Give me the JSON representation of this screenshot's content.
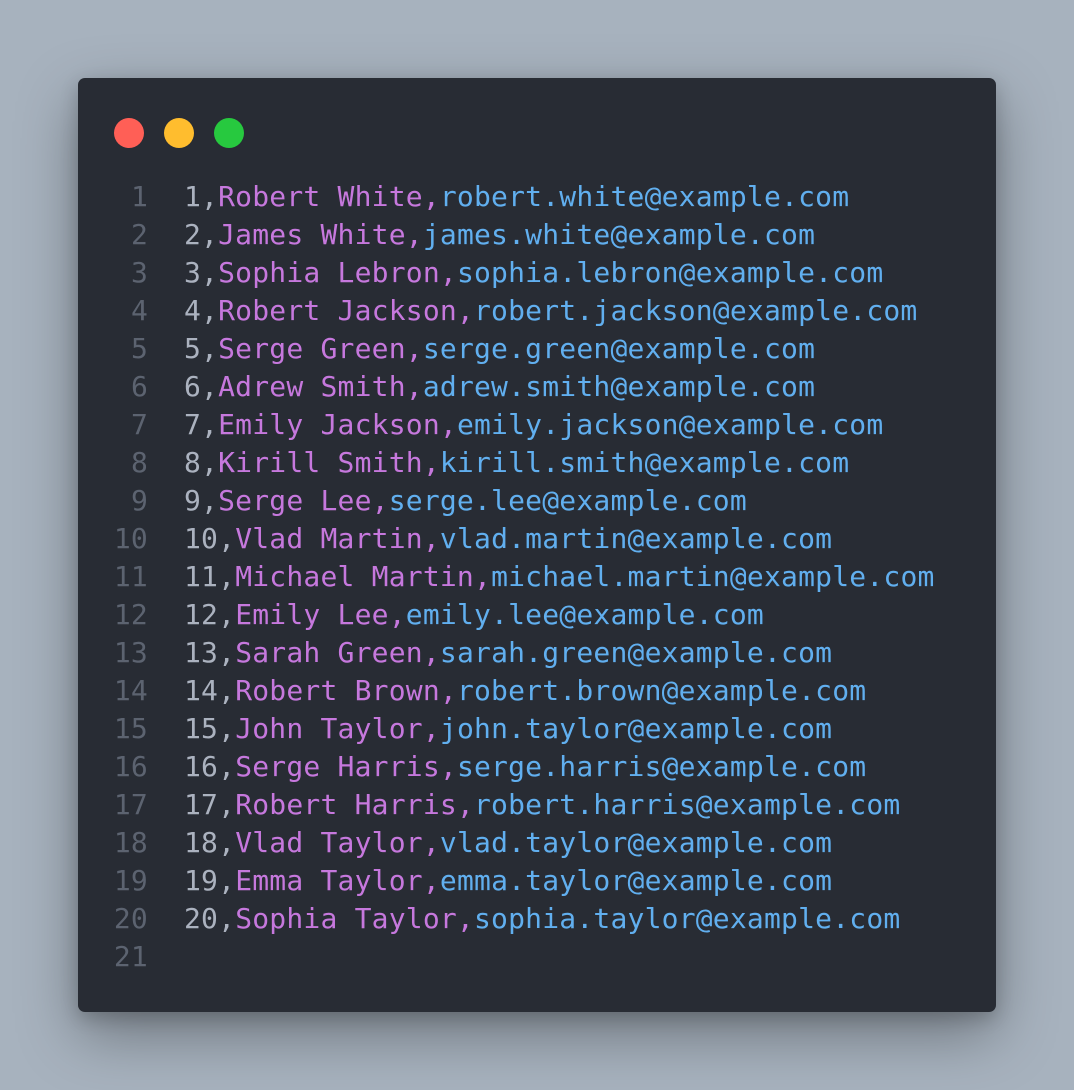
{
  "colors": {
    "background": "#a7b2be",
    "editor_background": "#282c34",
    "line_number": "#5c6370",
    "plain_text": "#abb2bf",
    "name_text": "#c678dd",
    "email_text": "#61afef",
    "dot_close": "#ff5f56",
    "dot_minimize": "#ffbd2e",
    "dot_maximize": "#27c93f"
  },
  "window_controls": [
    "close-dot",
    "minimize-dot",
    "maximize-dot"
  ],
  "lines": [
    {
      "n": "1",
      "plain": "1,",
      "name": "Robert White,",
      "email": "robert.white@example.com"
    },
    {
      "n": "2",
      "plain": "2,",
      "name": "James White,",
      "email": "james.white@example.com"
    },
    {
      "n": "3",
      "plain": "3,",
      "name": "Sophia Lebron,",
      "email": "sophia.lebron@example.com"
    },
    {
      "n": "4",
      "plain": "4,",
      "name": "Robert Jackson,",
      "email": "robert.jackson@example.com"
    },
    {
      "n": "5",
      "plain": "5,",
      "name": "Serge Green,",
      "email": "serge.green@example.com"
    },
    {
      "n": "6",
      "plain": "6,",
      "name": "Adrew Smith,",
      "email": "adrew.smith@example.com"
    },
    {
      "n": "7",
      "plain": "7,",
      "name": "Emily Jackson,",
      "email": "emily.jackson@example.com"
    },
    {
      "n": "8",
      "plain": "8,",
      "name": "Kirill Smith,",
      "email": "kirill.smith@example.com"
    },
    {
      "n": "9",
      "plain": "9,",
      "name": "Serge Lee,",
      "email": "serge.lee@example.com"
    },
    {
      "n": "10",
      "plain": "10,",
      "name": "Vlad Martin,",
      "email": "vlad.martin@example.com"
    },
    {
      "n": "11",
      "plain": "11,",
      "name": "Michael Martin,",
      "email": "michael.martin@example.com"
    },
    {
      "n": "12",
      "plain": "12,",
      "name": "Emily Lee,",
      "email": "emily.lee@example.com"
    },
    {
      "n": "13",
      "plain": "13,",
      "name": "Sarah Green,",
      "email": "sarah.green@example.com"
    },
    {
      "n": "14",
      "plain": "14,",
      "name": "Robert Brown,",
      "email": "robert.brown@example.com"
    },
    {
      "n": "15",
      "plain": "15,",
      "name": "John Taylor,",
      "email": "john.taylor@example.com"
    },
    {
      "n": "16",
      "plain": "16,",
      "name": "Serge Harris,",
      "email": "serge.harris@example.com"
    },
    {
      "n": "17",
      "plain": "17,",
      "name": "Robert Harris,",
      "email": "robert.harris@example.com"
    },
    {
      "n": "18",
      "plain": "18,",
      "name": "Vlad Taylor,",
      "email": "vlad.taylor@example.com"
    },
    {
      "n": "19",
      "plain": "19,",
      "name": "Emma Taylor,",
      "email": "emma.taylor@example.com"
    },
    {
      "n": "20",
      "plain": "20,",
      "name": "Sophia Taylor,",
      "email": "sophia.taylor@example.com"
    },
    {
      "n": "21",
      "plain": "",
      "name": "",
      "email": ""
    }
  ]
}
